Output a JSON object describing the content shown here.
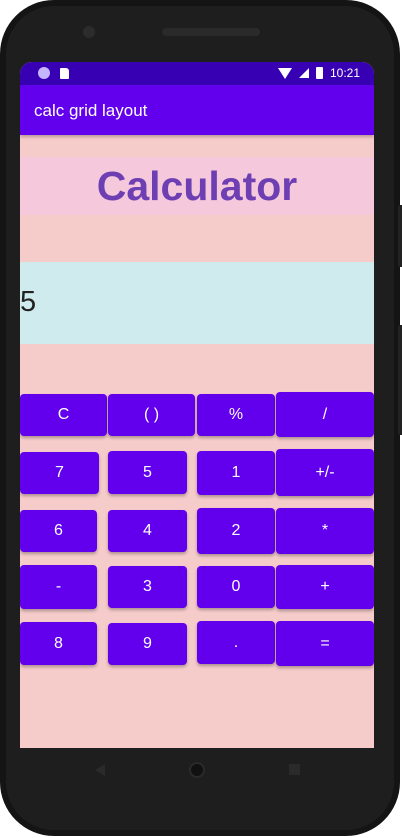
{
  "status_bar": {
    "time": "10:21"
  },
  "app_bar": {
    "title": "calc grid layout"
  },
  "main": {
    "heading": "Calculator",
    "display_value": "5",
    "buttons": [
      "C",
      "( )",
      "%",
      "/",
      "7",
      "5",
      "1",
      "+/-",
      "6",
      "4",
      "2",
      "*",
      "-",
      "3",
      "0",
      "+",
      "8",
      "9",
      ".",
      "="
    ]
  },
  "colors": {
    "primary": "#6200ee",
    "status_bar": "#3700b3",
    "background": "#f6cccb",
    "title_band": "#f5c8dc",
    "title_text": "#6e3fb3",
    "display_band": "#d0ebee"
  }
}
